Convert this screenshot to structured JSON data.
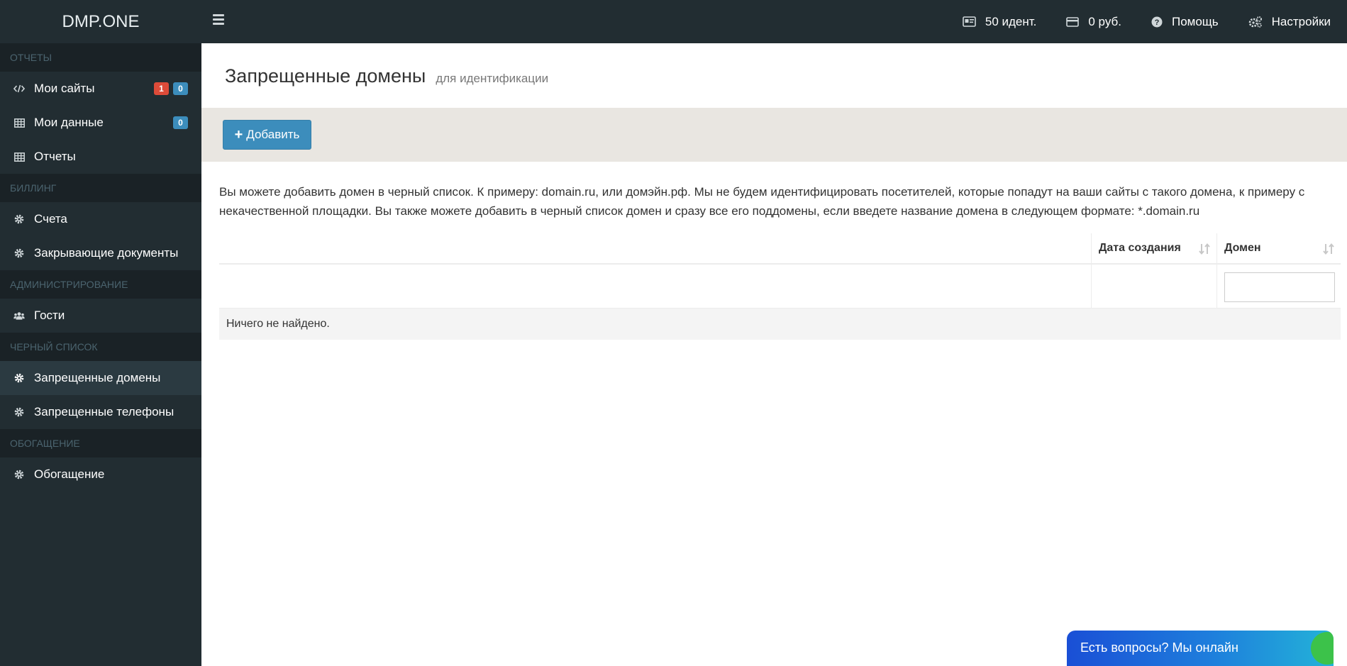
{
  "app": {
    "logo": "DMP.ONE"
  },
  "topnav": {
    "identifications": "50 идент.",
    "balance": "0 руб.",
    "help": "Помощь",
    "settings": "Настройки"
  },
  "sidebar": {
    "sections": [
      {
        "header": "ОТЧЕТЫ",
        "items": [
          {
            "label": "Мои сайты",
            "icon": "code-icon",
            "badges": [
              {
                "value": "1",
                "color": "#dd4b39"
              },
              {
                "value": "0",
                "color": "#3c8dbc"
              }
            ]
          },
          {
            "label": "Мои данные",
            "icon": "table-icon",
            "badges": [
              {
                "value": "0",
                "color": "#3c8dbc"
              }
            ]
          },
          {
            "label": "Отчеты",
            "icon": "table-icon"
          }
        ]
      },
      {
        "header": "БИЛЛИНГ",
        "items": [
          {
            "label": "Счета",
            "icon": "gear-icon"
          },
          {
            "label": "Закрывающие документы",
            "icon": "gear-icon"
          }
        ]
      },
      {
        "header": "АДМИНИСТРИРОВАНИЕ",
        "items": [
          {
            "label": "Гости",
            "icon": "users-icon"
          }
        ]
      },
      {
        "header": "ЧЕРНЫЙ СПИСОК",
        "items": [
          {
            "label": "Запрещенные домены",
            "icon": "gear-icon",
            "active": true
          },
          {
            "label": "Запрещенные телефоны",
            "icon": "gear-icon"
          }
        ]
      },
      {
        "header": "ОБОГАЩЕНИЕ",
        "items": [
          {
            "label": "Обогащение",
            "icon": "gear-icon"
          }
        ]
      }
    ]
  },
  "page": {
    "title": "Запрещенные домены",
    "subtitle": "для идентификации",
    "add_button": "Добавить",
    "description": "Вы можете добавить домен в черный список. К примеру: domain.ru, или домэйн.рф. Мы не будем идентифицировать посетителей, которые попадут на ваши сайты с такого домена, к примеру с некачественной площадки. Вы также можете добавить в черный список домен и сразу все его поддомены, если введете название домена в следующем формате: *.domain.ru"
  },
  "grid": {
    "columns": {
      "created": "Дата создания",
      "domain": "Домен"
    },
    "domain_filter_value": "",
    "empty_text": "Ничего не найдено."
  },
  "chat": {
    "label": "Есть вопросы? Мы онлайн"
  },
  "colors": {
    "sidebar_bg": "#222d32",
    "section_header_bg": "#1a2226",
    "accent": "#3c8dbc",
    "badge_red": "#dd4b39",
    "toolbar_bg": "#e9e6e1"
  }
}
